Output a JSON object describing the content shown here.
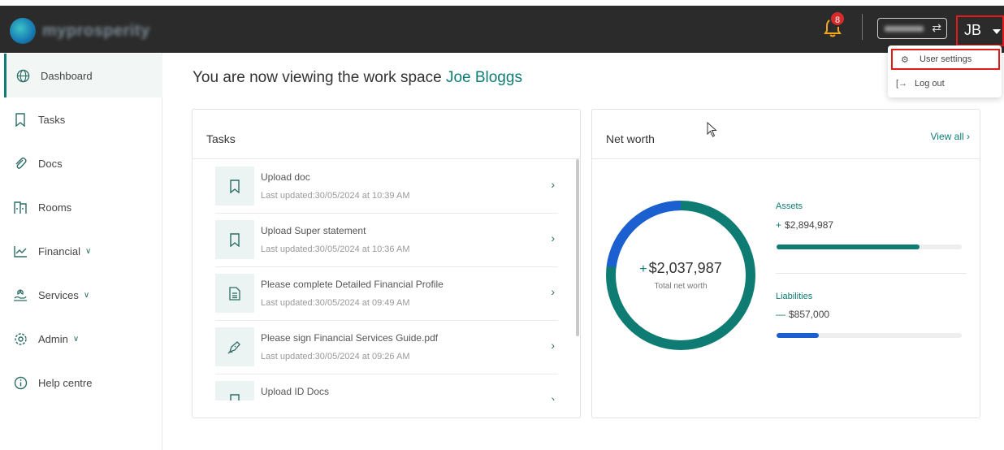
{
  "app": {
    "logo_text": "myprosperity"
  },
  "header": {
    "notification_count": "8",
    "workspace_switch_icon": "swap-icon",
    "user_initials": "JB"
  },
  "user_menu": {
    "items": [
      {
        "label": "User settings",
        "icon": "gear-icon"
      },
      {
        "label": "Log out",
        "icon": "logout-icon"
      }
    ]
  },
  "sidebar": {
    "items": [
      {
        "label": "Dashboard",
        "icon": "globe-icon",
        "active": true
      },
      {
        "label": "Tasks",
        "icon": "bookmark-icon"
      },
      {
        "label": "Docs",
        "icon": "paperclip-icon"
      },
      {
        "label": "Rooms",
        "icon": "rooms-icon"
      },
      {
        "label": "Financial",
        "icon": "chart-icon",
        "expandable": true
      },
      {
        "label": "Services",
        "icon": "services-icon",
        "expandable": true
      },
      {
        "label": "Admin",
        "icon": "admin-gear-icon",
        "expandable": true
      },
      {
        "label": "Help centre",
        "icon": "info-icon"
      }
    ]
  },
  "main": {
    "title_prefix": "You are now viewing the work space",
    "workspace_name": "Joe Bloggs"
  },
  "tasks_card": {
    "title": "Tasks",
    "items": [
      {
        "name": "Upload doc",
        "updated": "Last updated:30/05/2024 at 10:39 AM",
        "icon": "bookmark-icon"
      },
      {
        "name": "Upload Super statement",
        "updated": "Last updated:30/05/2024 at 10:36 AM",
        "icon": "bookmark-icon"
      },
      {
        "name": "Please complete Detailed Financial Profile",
        "updated": "Last updated:30/05/2024 at 09:49 AM",
        "icon": "document-icon"
      },
      {
        "name": "Please sign Financial Services Guide.pdf",
        "updated": "Last updated:30/05/2024 at 09:26 AM",
        "icon": "signature-icon"
      },
      {
        "name": "Upload ID Docs",
        "updated": "",
        "icon": "bookmark-icon"
      }
    ]
  },
  "networth_card": {
    "title": "Net worth",
    "view_all": "View all",
    "total_sign": "+",
    "total": "$2,037,987",
    "total_label": "Total net worth",
    "assets": {
      "label": "Assets",
      "sign": "+",
      "amount": "$2,894,987",
      "fraction": 0.77,
      "color": "#0e7c72"
    },
    "liabilities": {
      "label": "Liabilities",
      "sign": "—",
      "amount": "$857,000",
      "fraction": 0.23,
      "color": "#1b5fd1"
    }
  },
  "colors": {
    "accent": "#0e7c72",
    "liability": "#1b5fd1",
    "topbar": "#2b2b2b",
    "highlight": "#e21b1b",
    "bell": "#f2a81d"
  }
}
